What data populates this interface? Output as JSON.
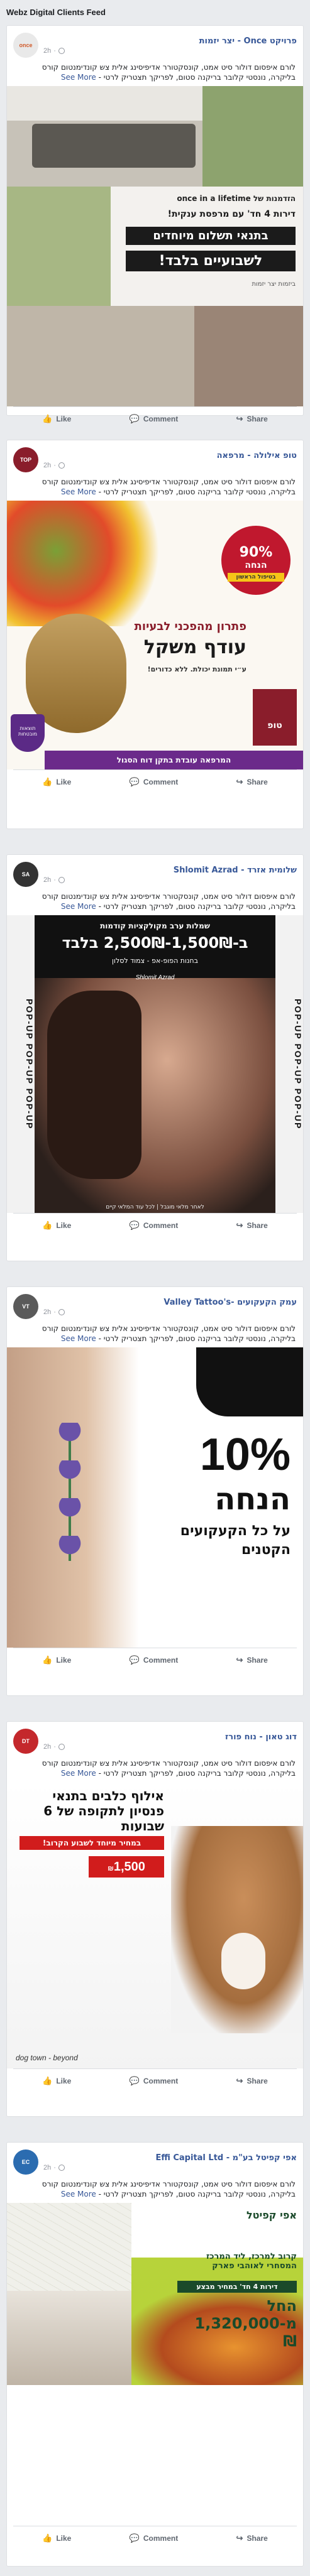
{
  "feed_title": "Webz Digital Clients Feed",
  "actions": {
    "like": "Like",
    "comment": "Comment",
    "share": "Share"
  },
  "post_time": "2h",
  "see_more": "See More",
  "post_text": "לורם איפסום דולור סיט אמט, קונסקטורר אדיפיסינג אלית צש קונדימנטום קורס בליקרה, נונסטי קלובר בריקנה סטום, לפריקך תצטריק לרטי -",
  "posts": [
    {
      "page_name": "פרויקט Once - יצר יזמות",
      "avatar": "once",
      "avatar_color": "#e9e9e9",
      "creative": {
        "line1": "הזדמנות של once in a lifetime",
        "line2": "דירות 4 חד' עם מרפסת ענקית!",
        "line3": "בתנאי תשלום מיוחדים",
        "line4": "לשבועיים בלבד!",
        "line5": "ביזמות יצר יזמות"
      }
    },
    {
      "page_name": "טופ אילולה - מרפאה",
      "avatar": "TOP",
      "avatar_color": "#8a1d2b",
      "creative": {
        "badge_title": "הנחה",
        "badge_pct": "90%",
        "badge_sub": "בטיפול הראשון",
        "headline1": "פתרון מהפכני לבעיות",
        "headline2": "עודף משקל",
        "headline3": "ע״י תמונת יכולת. ללא כדורים!",
        "logo": "טופ",
        "shield": "תוצאות מובטחות",
        "bar": "המרפאה עובדת בתקן דוח הסגול"
      }
    },
    {
      "page_name": "שלומית אזרד - Shlomit Azrad",
      "avatar": "SA",
      "avatar_color": "#333333",
      "creative": {
        "side_text": "POP-UP POP-UP POP-UP",
        "line1": "שמלות ערב מקולקציות קודמות",
        "line2": "ב-1,500₪-2,500₪ בלבד",
        "line3": "בחנות הפופ-אפ - צמוד לסלון",
        "signature": "Shlomit Azrad",
        "footer": "לאחר מלאי מוגבל | לכל עוד המלאי קיים"
      }
    },
    {
      "page_name": "עמק הקעקועים -Valley Tattoo's",
      "avatar": "VT",
      "avatar_color": "#5a5a5a",
      "creative": {
        "big": "10%",
        "line2": "הנחה",
        "line3": "על כל הקעקועים",
        "line4": "הקטנים"
      }
    },
    {
      "page_name": "דוג טאון - נוח פורז",
      "avatar": "DT",
      "avatar_color": "#c4282c",
      "creative": {
        "headline": "אילוף כלבים בתנאי פנסיון לתקופה של 6 שבועות",
        "ribbon": "במחיר מיוחד לשבוע הקרוב!",
        "price": "1,500",
        "currency": "₪",
        "signature": "dog town - beyond"
      }
    },
    {
      "page_name": "אפי קפיטל בע\"מ - Effi Capital Ltd",
      "avatar": "EC",
      "avatar_color": "#2b6cb0",
      "creative": {
        "logo": "אפי קפיטל",
        "line1": "קרוב למרכז, ליד המרכז המסחרי לאוהבי פארק",
        "line2": "דירות 4 חד' במחיר מבצע",
        "price": "החל מ-1,320,000 ₪"
      }
    }
  ]
}
